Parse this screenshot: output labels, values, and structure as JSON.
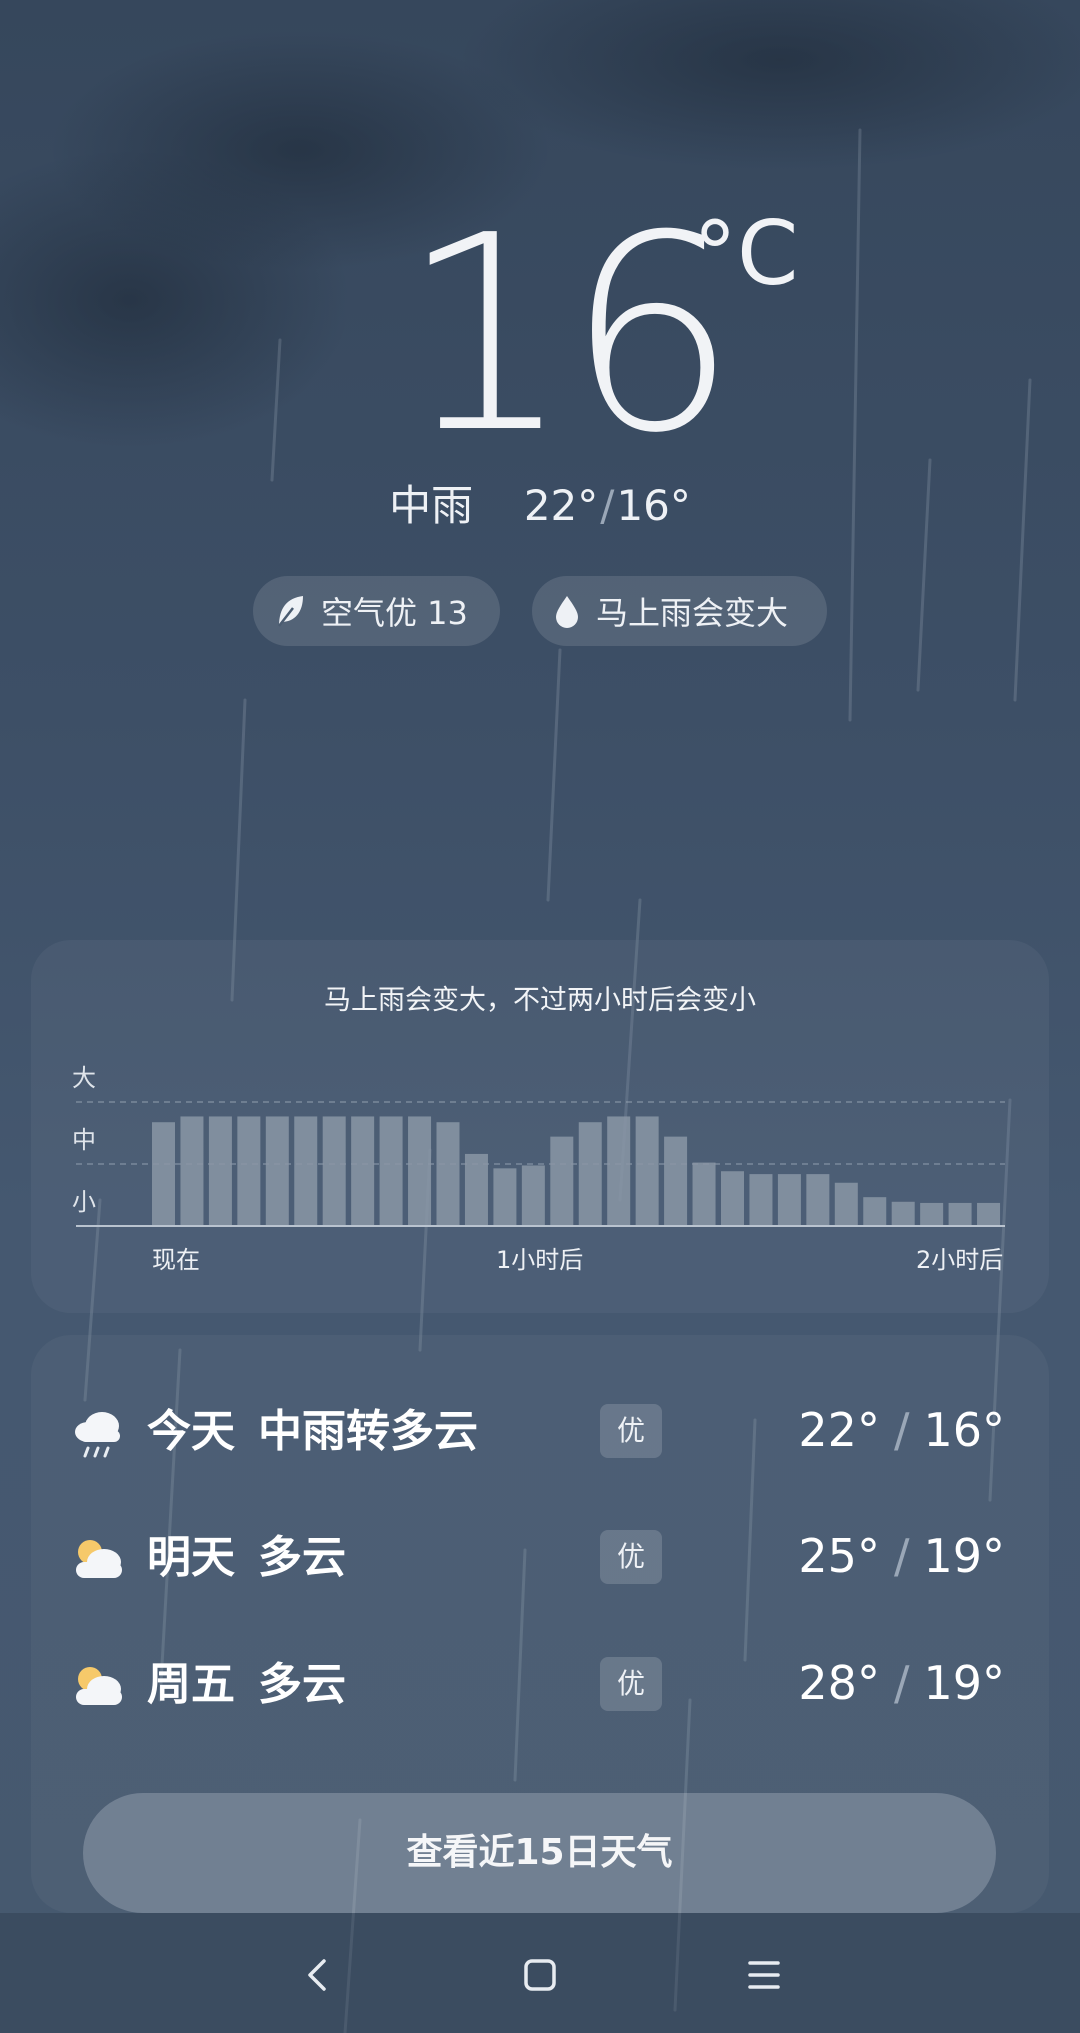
{
  "current": {
    "temperature": "16",
    "unit": "°C",
    "condition": "中雨",
    "high": "22°",
    "low": "16°"
  },
  "pills": {
    "air": {
      "icon": "leaf-icon",
      "label": "空气优 13"
    },
    "rain": {
      "icon": "raindrop-icon",
      "label": "马上雨会变大"
    }
  },
  "rain_chart": {
    "title": "马上雨会变大，不过两小时后会变小",
    "y_labels": [
      "大",
      "中",
      "小"
    ],
    "x_labels": [
      "现在",
      "1小时后",
      "2小时后"
    ]
  },
  "chart_data": {
    "type": "bar",
    "title": "马上雨会变大，不过两小时后会变小",
    "y_tick_labels": [
      "小",
      "中",
      "大"
    ],
    "x_tick_labels": [
      "现在",
      "1小时后",
      "2小时后"
    ],
    "ylim": [
      0,
      3
    ],
    "values": [
      1.8,
      1.9,
      1.9,
      1.9,
      1.9,
      1.9,
      1.9,
      1.9,
      1.9,
      1.9,
      1.8,
      1.25,
      1.0,
      1.05,
      1.55,
      1.8,
      1.9,
      1.9,
      1.55,
      1.1,
      0.95,
      0.9,
      0.9,
      0.9,
      0.75,
      0.5,
      0.42,
      0.4,
      0.4,
      0.4
    ],
    "grid": "dashed at 中 and 小",
    "bar_color": "#8a96a6"
  },
  "forecast": [
    {
      "icon": "rain-cloud-icon",
      "day": "今天",
      "desc": "中雨转多云",
      "aqi": "优",
      "high": "22°",
      "low": "16°"
    },
    {
      "icon": "partly-cloudy-icon",
      "day": "明天",
      "desc": "多云",
      "aqi": "优",
      "high": "25°",
      "low": "19°"
    },
    {
      "icon": "partly-cloudy-icon",
      "day": "周五",
      "desc": "多云",
      "aqi": "优",
      "high": "28°",
      "low": "19°"
    }
  ],
  "forecast_button": "查看近15日天气",
  "nav": {
    "back": "back-icon",
    "home": "home-icon",
    "menu": "menu-icon"
  }
}
